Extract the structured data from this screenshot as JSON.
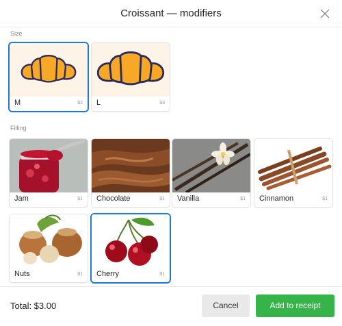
{
  "header": {
    "title": "Croissant — modifiers",
    "close_icon": "close-icon"
  },
  "sections": {
    "size": {
      "label": "Size",
      "items": [
        {
          "label": "M",
          "price": "$2",
          "selected": true,
          "icon": "croissant-icon"
        },
        {
          "label": "L",
          "price": "$3",
          "selected": false,
          "icon": "croissant-icon"
        }
      ]
    },
    "filling": {
      "label": "Filling",
      "items": [
        {
          "label": "Jam",
          "price": "$1",
          "selected": false,
          "image": "jam-jar"
        },
        {
          "label": "Chocolate",
          "price": "$1",
          "selected": false,
          "image": "chocolate"
        },
        {
          "label": "Vanilla",
          "price": "$1",
          "selected": false,
          "image": "vanilla"
        },
        {
          "label": "Cinnamon",
          "price": "$1",
          "selected": false,
          "image": "cinnamon"
        },
        {
          "label": "Nuts",
          "price": "$1",
          "selected": false,
          "image": "hazelnuts"
        },
        {
          "label": "Cherry",
          "price": "$1",
          "selected": true,
          "image": "cherry"
        }
      ]
    }
  },
  "footer": {
    "total": "Total: $3.00",
    "cancel_label": "Cancel",
    "add_label": "Add to receipt"
  },
  "colors": {
    "accent": "#1d79d4",
    "primary_button": "#36b44a",
    "secondary_button": "#e9e9e9",
    "croissant_fill": "#f7a826",
    "croissant_outline": "#2b2b5a",
    "tile_background": "#fdf3e6"
  }
}
